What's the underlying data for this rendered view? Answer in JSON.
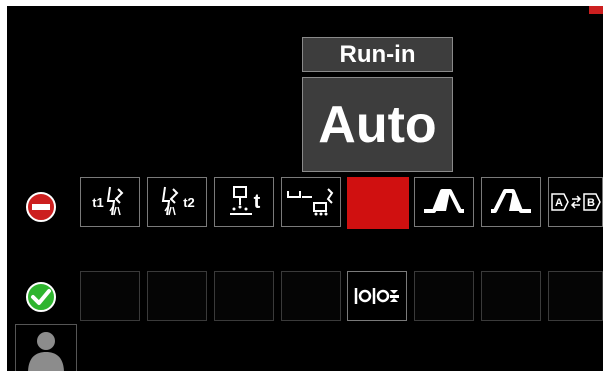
{
  "header": {
    "parameter_title": "Run-in",
    "parameter_value": "Auto"
  },
  "colors": {
    "background": "#000000",
    "selected": "#d01010",
    "disable": "#cc1f1f",
    "enable": "#2fb52f"
  },
  "disabled_row": {
    "icon": "disable-icon",
    "tiles": [
      {
        "name": "preflow-icon",
        "label": "t1"
      },
      {
        "name": "postflow-icon",
        "label": "t2"
      },
      {
        "name": "spot-timer-icon",
        "label": "t"
      },
      {
        "name": "crater-timer-icon",
        "label": ""
      },
      {
        "name": "selected-empty-tile",
        "label": ""
      },
      {
        "name": "start-procedure-icon",
        "label": ""
      },
      {
        "name": "end-procedure-icon",
        "label": ""
      },
      {
        "name": "dual-procedure-ab-icon",
        "label": ""
      }
    ]
  },
  "enabled_row": {
    "icon": "enable-icon",
    "tiles": [
      {
        "name": "empty-slot-1",
        "label": ""
      },
      {
        "name": "empty-slot-2",
        "label": ""
      },
      {
        "name": "empty-slot-3",
        "label": ""
      },
      {
        "name": "empty-slot-4",
        "label": ""
      },
      {
        "name": "run-in-icon",
        "label": ""
      },
      {
        "name": "empty-slot-5",
        "label": ""
      },
      {
        "name": "empty-slot-6",
        "label": ""
      },
      {
        "name": "empty-slot-7",
        "label": ""
      }
    ]
  },
  "user": {
    "icon": "user-icon"
  }
}
